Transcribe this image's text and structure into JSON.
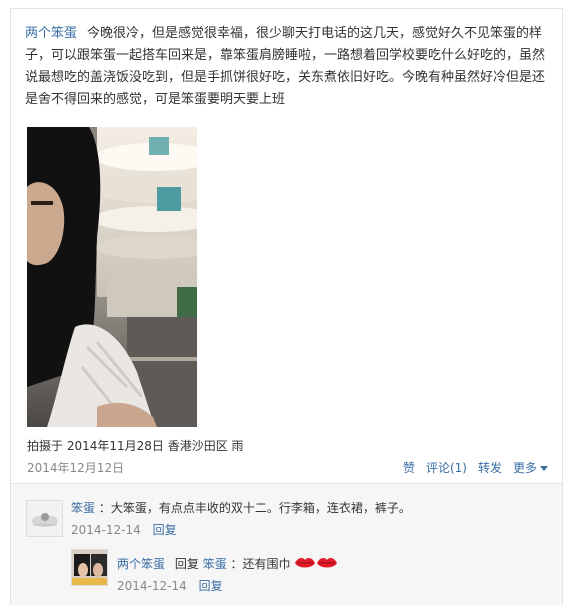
{
  "post": {
    "author": "两个笨蛋",
    "text": "今晚很冷，但是感觉很幸福，很少聊天打电话的这几天，感觉好久不见笨蛋的样子，可以跟笨蛋一起搭车回来是，靠笨蛋肩膀睡啦，一路想着回学校要吃什么好吃的，虽然说最想吃的盖浇饭没吃到，但是手抓饼很好吃，关东煮依旧好吃。今晚有种虽然好冷但是还是舍不得回来的感觉，可是笨蛋要明天要上班",
    "photo_meta": "拍摄于 2014年11月28日 香港沙田区 雨",
    "date": "2014年12月12日",
    "actions": {
      "like": "赞",
      "comment": "评论(1)",
      "repost": "转发",
      "more": "更多"
    }
  },
  "comments": [
    {
      "author": "笨蛋",
      "text": "：大笨蛋，有点点丰收的双十二。行李箱，连衣裙，裤子。",
      "date": "2014-12-14",
      "reply_label": "回复"
    },
    {
      "author": "两个笨蛋",
      "reply_word": "回复",
      "reply_to": "笨蛋",
      "text": "：还有围巾",
      "date": "2014-12-14",
      "reply_label": "回复"
    }
  ],
  "colors": {
    "link": "#3a6ea5",
    "muted": "#888888",
    "comment_bg": "#f6f6f6",
    "lips": "#e21b2a"
  }
}
